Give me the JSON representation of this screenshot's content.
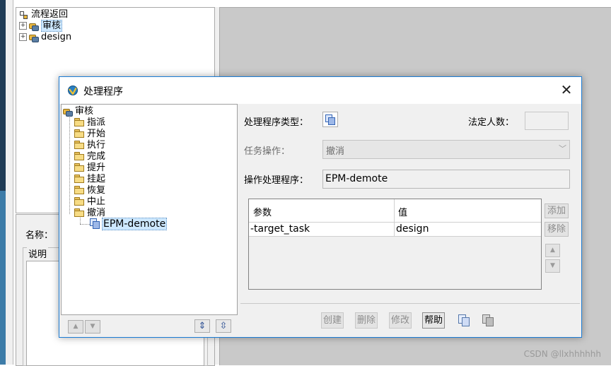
{
  "background": {
    "tree": {
      "items": [
        {
          "label": "流程返回",
          "expander": ""
        },
        {
          "label": "审核",
          "expander": "+"
        },
        {
          "label": "design",
          "expander": "+"
        }
      ]
    },
    "name_label": "名称：",
    "desc_label": "说明"
  },
  "dialog": {
    "title": "处理程序",
    "close_glyph": "✕",
    "tree": {
      "root": "审核",
      "folders": [
        "指派",
        "开始",
        "执行",
        "完成",
        "提升",
        "挂起",
        "恢复",
        "中止",
        "撤消"
      ],
      "leaf": "EPM-demote"
    },
    "left_toolbar": {
      "up_glyph": "▲",
      "down_glyph": "▼",
      "expand_glyph": "⇕",
      "collapse_glyph": "⇳"
    },
    "form": {
      "handler_type_label": "处理程序类型：",
      "quorum_label": "法定人数：",
      "quorum_value": "",
      "task_action_label": "任务操作：",
      "task_action_value": "撤消",
      "dropdown_glyph": "﹀",
      "action_handler_label": "操作处理程序：",
      "action_handler_value": "EPM-demote"
    },
    "args_table": {
      "headers": [
        "参数",
        "值"
      ],
      "rows": [
        {
          "param": "-target_task",
          "value": "design"
        }
      ]
    },
    "side_buttons": {
      "add": "添加",
      "remove": "移除",
      "up_glyph": "▲",
      "down_glyph": "▼"
    },
    "bottom_buttons": {
      "create": "创建",
      "delete": "删除",
      "modify": "修改",
      "help": "帮助"
    }
  },
  "watermark": "CSDN @llxhhhhhh",
  "colors": {
    "accent_border": "#1b7bd4",
    "selection": "#cde8ff",
    "workspace_gray": "#c9c9c9"
  }
}
